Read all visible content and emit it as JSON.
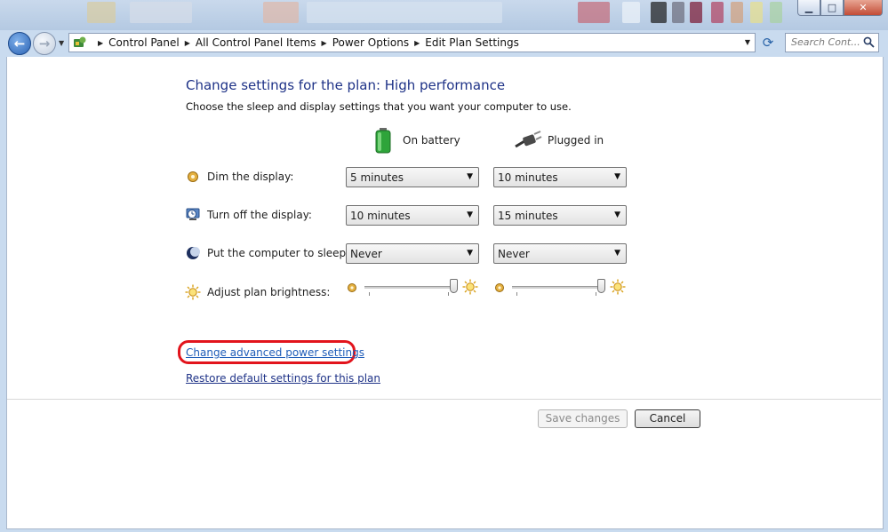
{
  "window": {
    "minimize_glyph": "▁",
    "maximize_glyph": "□",
    "close_glyph": "✕"
  },
  "navigation": {
    "back_glyph": "←",
    "forward_glyph": "→",
    "recent_glyph": "▼",
    "breadcrumbs": [
      "Control Panel",
      "All Control Panel Items",
      "Power Options",
      "Edit Plan Settings"
    ],
    "crumb_separator": "▶",
    "address_dropdown_glyph": "▼",
    "refresh_glyph": "⟳",
    "search_placeholder": "Search Cont..."
  },
  "main": {
    "title": "Change settings for the plan: High performance",
    "subtitle": "Choose the sleep and display settings that you want your computer to use.",
    "columns": {
      "battery": "On battery",
      "plugged": "Plugged in"
    },
    "settings": [
      {
        "label": "Dim the display:",
        "icon": "dim-display-icon",
        "battery": "5 minutes",
        "plugged": "10 minutes"
      },
      {
        "label": "Turn off the display:",
        "icon": "display-off-icon",
        "battery": "10 minutes",
        "plugged": "15 minutes"
      },
      {
        "label": "Put the computer to sleep:",
        "icon": "sleep-icon",
        "battery": "Never",
        "plugged": "Never"
      }
    ],
    "dropdown_glyph": "▼",
    "brightness": {
      "label": "Adjust plan brightness:",
      "battery_level": 1.0,
      "plugged_level": 1.0
    },
    "links": {
      "advanced": "Change advanced power settings",
      "restore": "Restore default settings for this plan"
    },
    "buttons": {
      "save": "Save changes",
      "cancel": "Cancel"
    }
  },
  "colors": {
    "title": "#1e3287",
    "link": "#1e5cb8",
    "highlight_ring": "#e2141c",
    "chrome": "#c9dbef"
  }
}
